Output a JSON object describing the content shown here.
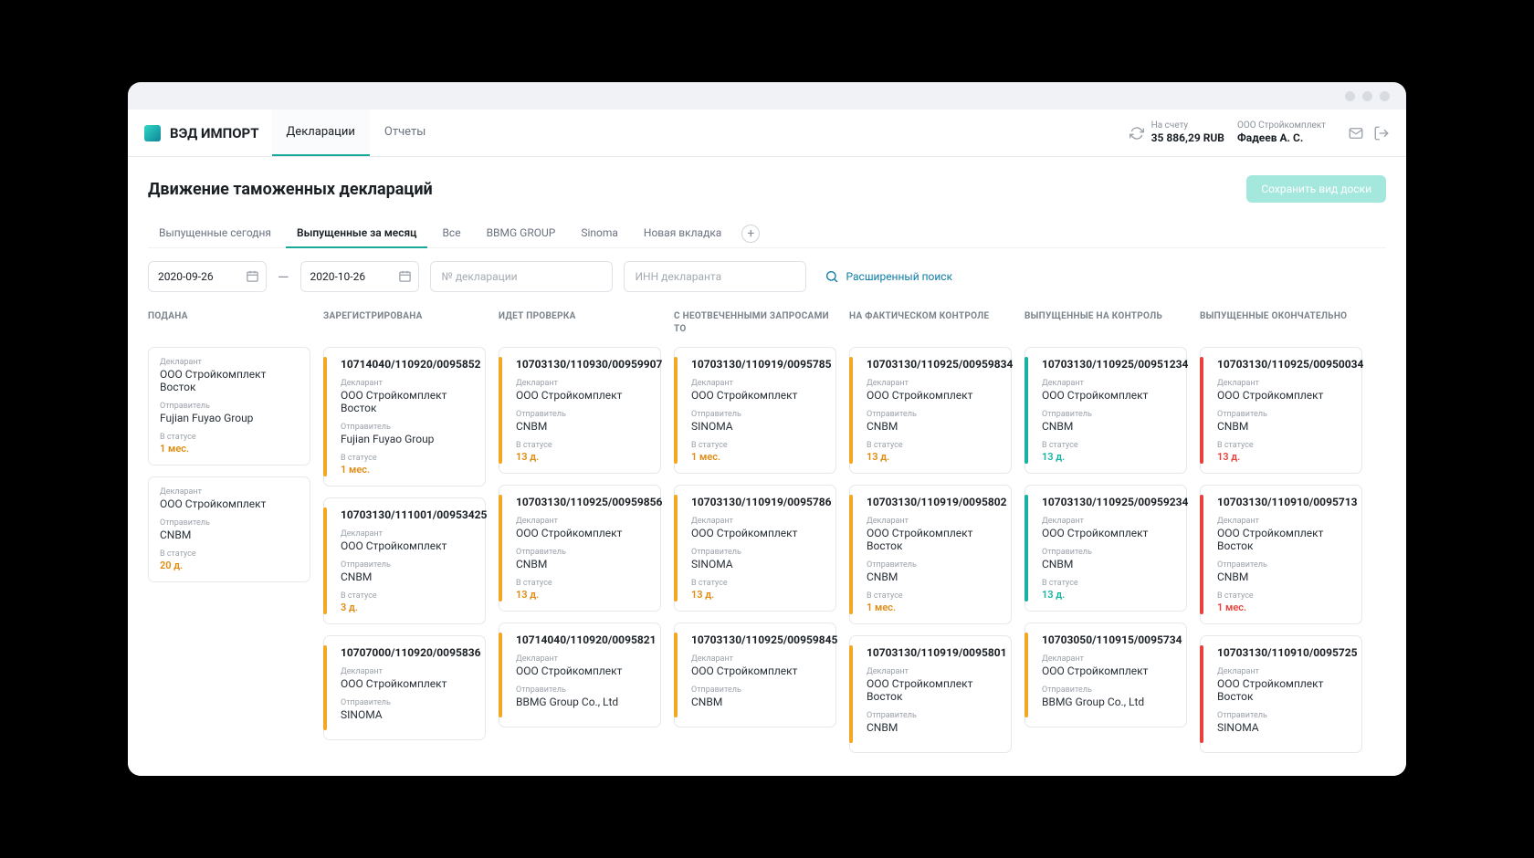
{
  "header": {
    "brand": "ВЭД ИМПОРТ",
    "nav": [
      "Декларации",
      "Отчеты"
    ],
    "nav_active": 0,
    "balance_label": "На счету",
    "balance_value": "35 886,29 RUB",
    "company": "ООО Стройкомплект",
    "user": "Фадеев А. С."
  },
  "page": {
    "title": "Движение таможенных деклараций",
    "save_btn": "Сохранить вид доски"
  },
  "tabs": [
    "Выпущенные сегодня",
    "Выпущенные за месяц",
    "Все",
    "BBMG GROUP",
    "Sinoma",
    "Новая вкладка"
  ],
  "tabs_active": 1,
  "filters": {
    "date_from": "2020-09-26",
    "date_to": "2020-10-26",
    "decl_no_ph": "№ декларации",
    "inn_ph": "ИНН декларанта",
    "advanced": "Расширенный поиск"
  },
  "field_labels": {
    "declarant": "Декларант",
    "sender": "Отправитель",
    "in_status": "В статусе"
  },
  "columns": [
    {
      "title": "ПОДАНА",
      "cards": [
        {
          "simple": true,
          "declarant": "ООО Стройкомплект Восток",
          "sender": "Fujian Fuyao Group",
          "status": "1 мес.",
          "color": "orange"
        },
        {
          "simple": true,
          "declarant": "ООО Стройкомплект",
          "sender": "CNBM",
          "status": "20 д.",
          "color": "orange"
        }
      ]
    },
    {
      "title": "ЗАРЕГИСТРИРОВАНА",
      "cards": [
        {
          "bar": "orange",
          "id": "10714040/110920/0095852",
          "declarant": "ООО Стройкомплект Восток",
          "sender": "Fujian Fuyao Group",
          "status": "1 мес.",
          "color": "orange"
        },
        {
          "bar": "orange",
          "id": "10703130/111001/00953425",
          "declarant": "ООО Стройкомплект",
          "sender": "CNBM",
          "status": "3 д.",
          "color": "orange"
        },
        {
          "bar": "orange",
          "id": "10707000/110920/0095836",
          "declarant": "ООО Стройкомплект",
          "sender": "SINOMA"
        }
      ]
    },
    {
      "title": "ИДЕТ ПРОВЕРКА",
      "cards": [
        {
          "bar": "orange",
          "id": "10703130/110930/00959907",
          "declarant": "ООО Стройкомплект",
          "sender": "CNBM",
          "status": "13 д.",
          "color": "orange"
        },
        {
          "bar": "orange",
          "id": "10703130/110925/00959856",
          "declarant": "ООО Стройкомплект",
          "sender": "CNBM",
          "status": "13 д.",
          "color": "orange"
        },
        {
          "bar": "orange",
          "id": "10714040/110920/0095821",
          "declarant": "ООО Стройкомплект",
          "sender": "BBMG Group Co., Ltd"
        }
      ]
    },
    {
      "title": "С НЕОТВЕЧЕННЫМИ ЗАПРОСАМИ ТО",
      "cards": [
        {
          "bar": "orange",
          "id": "10703130/110919/0095785",
          "declarant": "ООО Стройкомплект",
          "sender": "SINOMA",
          "status": "1 мес.",
          "color": "orange"
        },
        {
          "bar": "orange",
          "id": "10703130/110919/0095786",
          "declarant": "ООО Стройкомплект",
          "sender": "SINOMA",
          "status": "13 д.",
          "color": "orange"
        },
        {
          "bar": "orange",
          "id": "10703130/110925/00959845",
          "declarant": "ООО Стройкомплект",
          "sender": "CNBM"
        }
      ]
    },
    {
      "title": "НА ФАКТИЧЕСКОМ КОНТРОЛЕ",
      "cards": [
        {
          "bar": "orange",
          "id": "10703130/110925/00959834",
          "declarant": "ООО Стройкомплект",
          "sender": "CNBM",
          "status": "13 д.",
          "color": "orange"
        },
        {
          "bar": "orange",
          "id": "10703130/110919/0095802",
          "declarant": "ООО Стройкомплект Восток",
          "sender": "CNBM",
          "status": "1 мес.",
          "color": "orange"
        },
        {
          "bar": "orange",
          "id": "10703130/110919/0095801",
          "declarant": "ООО Стройкомплект Восток",
          "sender": "CNBM"
        }
      ]
    },
    {
      "title": "ВЫПУЩЕННЫЕ НА КОНТРОЛЬ",
      "cards": [
        {
          "bar": "teal",
          "id": "10703130/110925/00951234",
          "declarant": "ООО Стройкомплект",
          "sender": "CNBM",
          "status": "13 д.",
          "color": "teal"
        },
        {
          "bar": "teal",
          "id": "10703130/110925/00959234",
          "declarant": "ООО Стройкомплект",
          "sender": "CNBM",
          "status": "13 д.",
          "color": "teal"
        },
        {
          "bar": "orange",
          "id": "10703050/110915/0095734",
          "declarant": "ООО Стройкомплект",
          "sender": "BBMG Group Co., Ltd"
        }
      ]
    },
    {
      "title": "ВЫПУЩЕННЫЕ ОКОНЧАТЕЛЬНО",
      "cards": [
        {
          "bar": "red",
          "id": "10703130/110925/00950034",
          "declarant": "ООО Стройкомплект",
          "sender": "CNBM",
          "status": "13 д.",
          "color": "red"
        },
        {
          "bar": "red",
          "id": "10703130/110910/0095713",
          "declarant": "ООО Стройкомплект Восток",
          "sender": "CNBM",
          "status": "1 мес.",
          "color": "red"
        },
        {
          "bar": "red",
          "id": "10703130/110910/0095725",
          "declarant": "ООО Стройкомплект Восток",
          "sender": "SINOMA"
        }
      ]
    }
  ]
}
